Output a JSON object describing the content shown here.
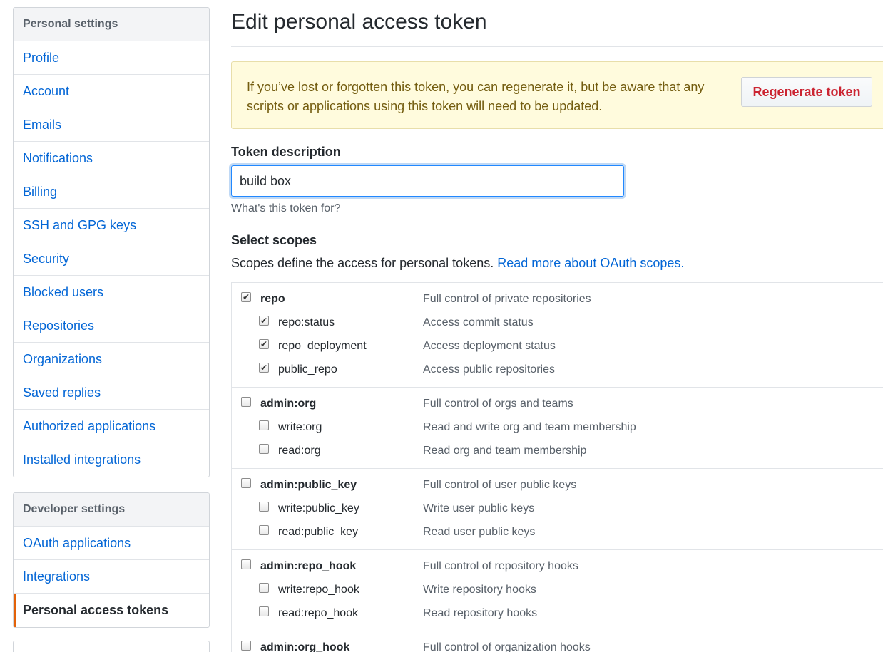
{
  "sidebar": {
    "personal": {
      "heading": "Personal settings",
      "items": [
        "Profile",
        "Account",
        "Emails",
        "Notifications",
        "Billing",
        "SSH and GPG keys",
        "Security",
        "Blocked users",
        "Repositories",
        "Organizations",
        "Saved replies",
        "Authorized applications",
        "Installed integrations"
      ]
    },
    "developer": {
      "heading": "Developer settings",
      "items": [
        "OAuth applications",
        "Integrations",
        "Personal access tokens"
      ],
      "selected": "Personal access tokens"
    }
  },
  "main": {
    "title": "Edit personal access token",
    "flash": {
      "text": "If you’ve lost or forgotten this token, you can regenerate it, but be aware that any scripts or applications using this token will need to be updated.",
      "button": "Regenerate token"
    },
    "token_description": {
      "label": "Token description",
      "value": "build box",
      "note": "What's this token for?"
    },
    "scopes": {
      "heading": "Select scopes",
      "intro": "Scopes define the access for personal tokens.",
      "link": "Read more about OAuth scopes.",
      "groups": [
        {
          "name": "repo",
          "desc": "Full control of private repositories",
          "checked": true,
          "children": [
            {
              "name": "repo:status",
              "desc": "Access commit status",
              "checked": true
            },
            {
              "name": "repo_deployment",
              "desc": "Access deployment status",
              "checked": true
            },
            {
              "name": "public_repo",
              "desc": "Access public repositories",
              "checked": true
            }
          ]
        },
        {
          "name": "admin:org",
          "desc": "Full control of orgs and teams",
          "checked": false,
          "children": [
            {
              "name": "write:org",
              "desc": "Read and write org and team membership",
              "checked": false
            },
            {
              "name": "read:org",
              "desc": "Read org and team membership",
              "checked": false
            }
          ]
        },
        {
          "name": "admin:public_key",
          "desc": "Full control of user public keys",
          "checked": false,
          "children": [
            {
              "name": "write:public_key",
              "desc": "Write user public keys",
              "checked": false
            },
            {
              "name": "read:public_key",
              "desc": "Read user public keys",
              "checked": false
            }
          ]
        },
        {
          "name": "admin:repo_hook",
          "desc": "Full control of repository hooks",
          "checked": false,
          "children": [
            {
              "name": "write:repo_hook",
              "desc": "Write repository hooks",
              "checked": false
            },
            {
              "name": "read:repo_hook",
              "desc": "Read repository hooks",
              "checked": false
            }
          ]
        },
        {
          "name": "admin:org_hook",
          "desc": "Full control of organization hooks",
          "checked": false,
          "children": []
        }
      ]
    }
  },
  "colors": {
    "link": "#0366d6",
    "selected_accent": "#e36209",
    "flash_bg": "#fffbdd",
    "danger": "#cb2431"
  }
}
